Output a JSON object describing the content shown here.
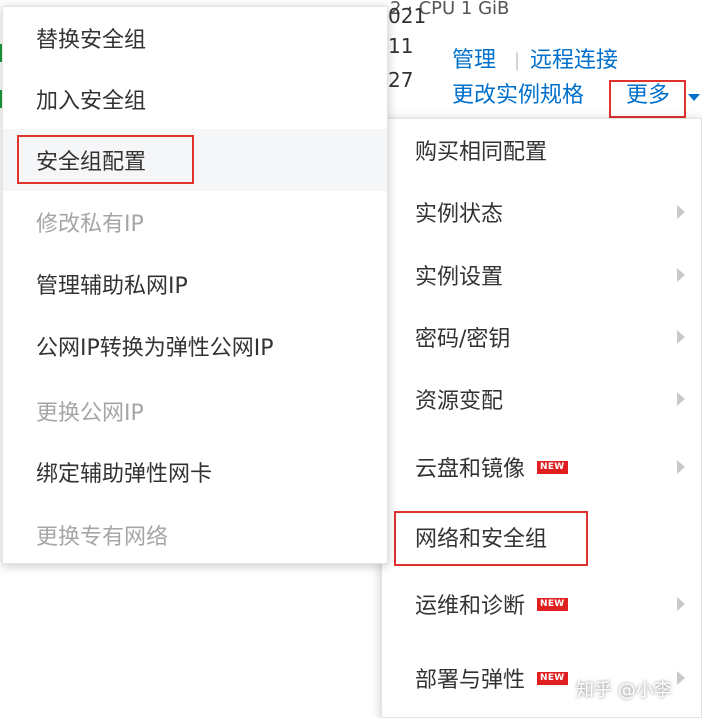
{
  "background": {
    "row_values": [
      "021",
      "11",
      "27"
    ],
    "top_fragment": "2 · CPU 1 GiB"
  },
  "actions": {
    "manage": "管理",
    "remote_connect": "远程连接",
    "change_spec": "更改实例规格",
    "more": "更多"
  },
  "left_menu": {
    "items": [
      {
        "label": "替换安全组",
        "disabled": false
      },
      {
        "label": "加入安全组",
        "disabled": false
      },
      {
        "label": "安全组配置",
        "disabled": false,
        "highlighted": true
      },
      {
        "label": "修改私有IP",
        "disabled": true
      },
      {
        "label": "管理辅助私网IP",
        "disabled": false
      },
      {
        "label": "公网IP转换为弹性公网IP",
        "disabled": false
      },
      {
        "label": "更换公网IP",
        "disabled": true
      },
      {
        "label": "绑定辅助弹性网卡",
        "disabled": false
      },
      {
        "label": "更换专有网络",
        "disabled": true
      }
    ]
  },
  "right_menu": {
    "items": [
      {
        "label": "购买相同配置",
        "submenu": false
      },
      {
        "label": "实例状态",
        "submenu": true
      },
      {
        "label": "实例设置",
        "submenu": true
      },
      {
        "label": "密码/密钥",
        "submenu": true
      },
      {
        "label": "资源变配",
        "submenu": true
      },
      {
        "label": "云盘和镜像",
        "submenu": true,
        "badge": "NEW"
      },
      {
        "label": "网络和安全组",
        "submenu": false,
        "highlighted": true
      },
      {
        "label": "运维和诊断",
        "submenu": true,
        "badge": "NEW"
      },
      {
        "label": "部署与弹性",
        "submenu": true,
        "badge": "NEW"
      }
    ]
  },
  "watermark": "知乎 @小李",
  "colors": {
    "link": "#0070cc",
    "highlight": "#e0322f",
    "badge": "#e02020"
  }
}
